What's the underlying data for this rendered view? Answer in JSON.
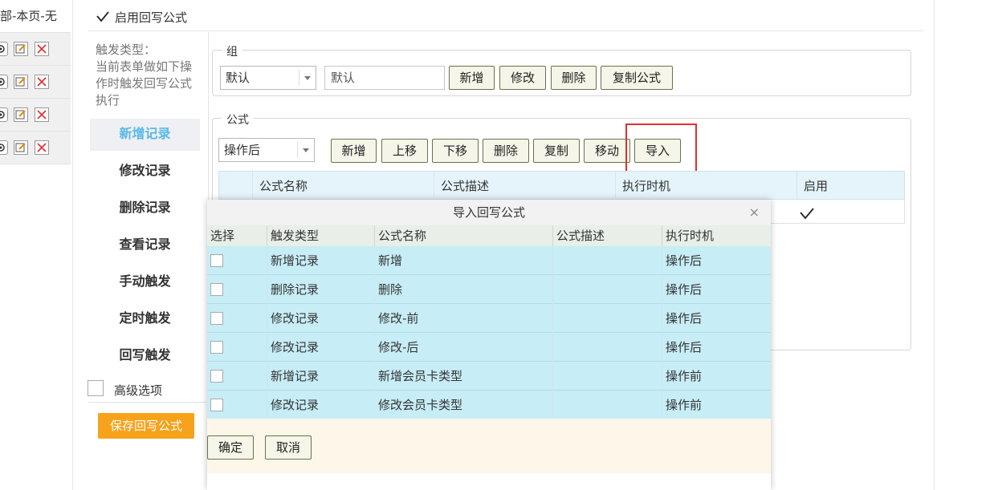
{
  "left_list": {
    "header_text": "部-本页-无",
    "rows": 4
  },
  "enable_checkbox": {
    "label": "启用回写公式",
    "checked": true
  },
  "trigger_desc": [
    "触发类型：",
    "当前表单做如下操",
    "作时触发回写公式",
    "执行"
  ],
  "sidebar": {
    "items": [
      "新增记录",
      "修改记录",
      "删除记录",
      "查看记录",
      "手动触发",
      "定时触发",
      "回写触发"
    ],
    "active_index": 0
  },
  "advanced": {
    "label": "高级选项",
    "checked": false
  },
  "save_button": "保存回写公式",
  "group_section": {
    "legend": "组",
    "select_value": "默认",
    "input_value": "默认",
    "buttons": [
      "新增",
      "修改",
      "删除",
      "复制公式"
    ]
  },
  "formula_section": {
    "legend": "公式",
    "select_value": "操作后",
    "buttons": [
      "新增",
      "上移",
      "下移",
      "删除",
      "复制",
      "移动",
      "导入"
    ],
    "columns": [
      "公式名称",
      "公式描述",
      "执行时机",
      "启用"
    ]
  },
  "dialog": {
    "title": "导入回写公式",
    "close": "×",
    "columns": [
      "选择",
      "触发类型",
      "公式名称",
      "公式描述",
      "执行时机"
    ],
    "rows": [
      {
        "trigger": "新增记录",
        "name": "新增",
        "desc": "",
        "timing": "操作后"
      },
      {
        "trigger": "删除记录",
        "name": "删除",
        "desc": "",
        "timing": "操作后"
      },
      {
        "trigger": "修改记录",
        "name": "修改-前",
        "desc": "",
        "timing": "操作后"
      },
      {
        "trigger": "修改记录",
        "name": "修改-后",
        "desc": "",
        "timing": "操作后"
      },
      {
        "trigger": "新增记录",
        "name": "新增会员卡类型",
        "desc": "",
        "timing": "操作前"
      },
      {
        "trigger": "修改记录",
        "name": "修改会员卡类型",
        "desc": "",
        "timing": "操作前"
      }
    ],
    "ok_button": "确定",
    "cancel_button": "取消"
  },
  "colors": {
    "active_sidebar_text": "#59b8e8",
    "save_button_bg": "#f7a21b",
    "dialog_row_bg": "#c7edf6",
    "highlight_box": "#e0302f"
  }
}
